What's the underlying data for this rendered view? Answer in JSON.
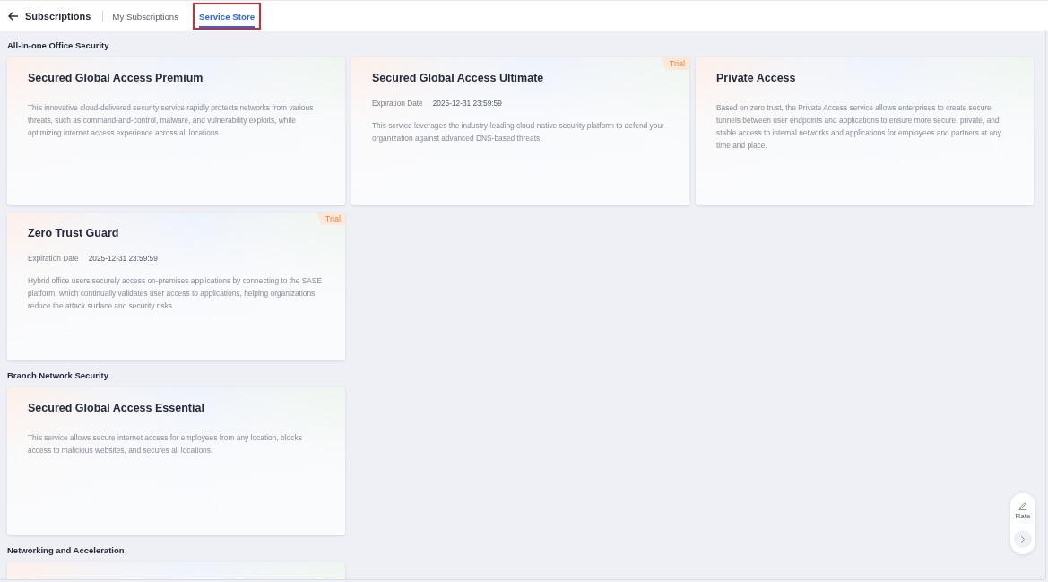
{
  "header": {
    "title": "Subscriptions",
    "tabs": [
      {
        "label": "My Subscriptions",
        "selected": false,
        "highlighted": false
      },
      {
        "label": "Service Store",
        "selected": true,
        "highlighted": true
      }
    ]
  },
  "sections": [
    {
      "title": "All-in-one Office Security",
      "services": [
        {
          "name": "Secured Global Access Premium",
          "description": "This innovative cloud-delivered security service rapidly protects networks from various threats, such as command-and-control, malware, and vulnerability exploits, while optimizing internet access experience across all locations."
        },
        {
          "name": "Secured Global Access Ultimate",
          "badge": "Trial",
          "expiration": {
            "label": "Expiration Date",
            "value": "2025-12-31 23:59:59"
          },
          "description": "This service leverages the industry-leading cloud-native security platform to defend your organization against advanced DNS-based threats."
        },
        {
          "name": "Private Access",
          "description": "Based on zero trust, the Private Access service allows enterprises to create secure tunnels between user endpoints and applications to ensure more secure, private, and stable access to internal networks and applications for employees and partners at any time and place."
        },
        {
          "name": "Zero Trust Guard",
          "badge": "Trial",
          "expiration": {
            "label": "Expiration Date",
            "value": "2025-12-31 23:59:59"
          },
          "description": "Hybrid office users securely access on-premises applications by connecting to the SASE platform, which continually validates user access to applications, helping organizations reduce the attack surface and security risks"
        }
      ]
    },
    {
      "title": "Branch Network Security",
      "services": [
        {
          "name": "Secured Global Access Essential",
          "description": "This service allows secure internet access for employees from any location, blocks access to malicious websites, and secures all locations."
        }
      ]
    },
    {
      "title": "Networking and Acceleration",
      "partial_card": true
    }
  ],
  "feedback": {
    "label": "Rate"
  }
}
